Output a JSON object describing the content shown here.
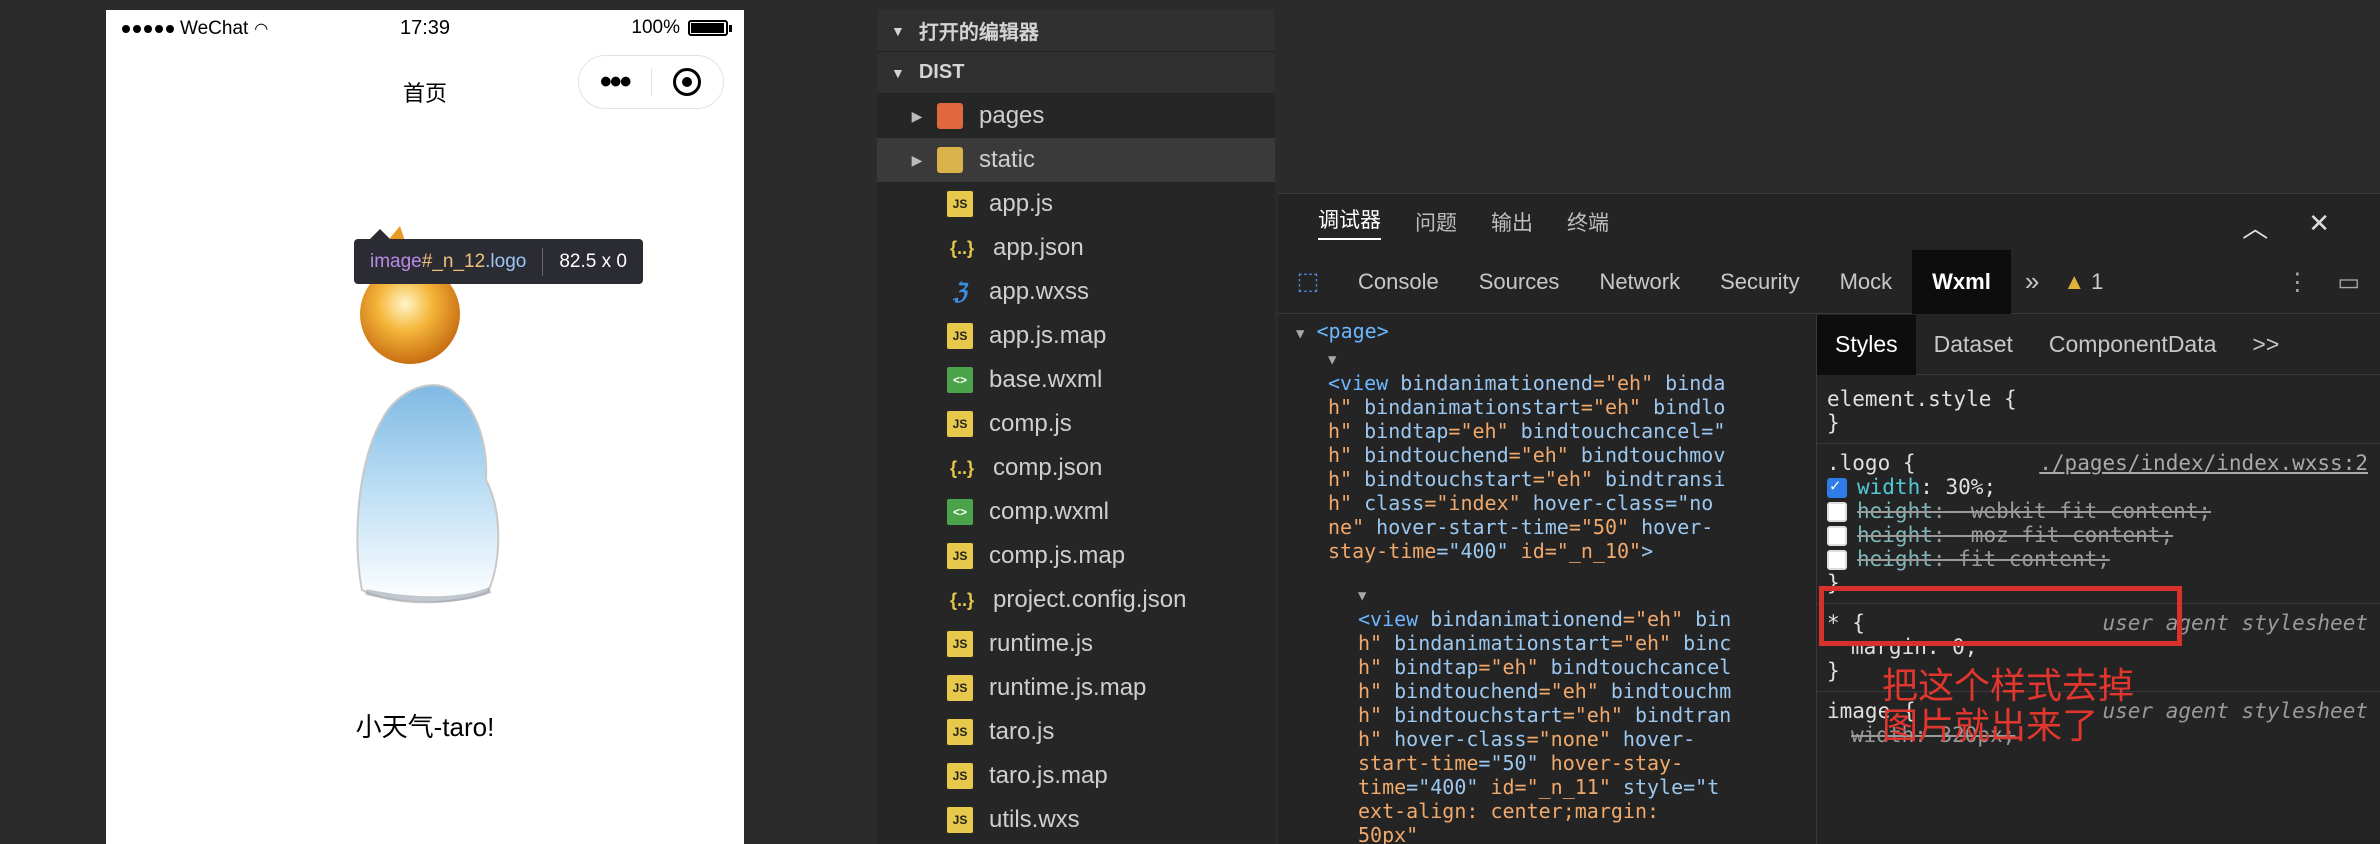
{
  "phone": {
    "carrier": "WeChat",
    "time": "17:39",
    "battery": "100%",
    "nav_title": "首页",
    "capsule_more": "•••",
    "inspect": {
      "tag": "image",
      "id": "#_n_12",
      "cls": ".logo",
      "size": "82.5 x 0"
    },
    "weather_text": "小天气-taro!"
  },
  "explorer": {
    "sections": [
      {
        "label": "打开的编辑器"
      },
      {
        "label": "DIST"
      }
    ],
    "items": [
      {
        "label": "pages",
        "icon": "folder-pages-icon",
        "kind": "folder"
      },
      {
        "label": "static",
        "icon": "folder-static-icon",
        "kind": "folder"
      },
      {
        "label": "app.js",
        "icon": "js-file-icon",
        "kind": "js"
      },
      {
        "label": "app.json",
        "icon": "json-file-icon",
        "kind": "json"
      },
      {
        "label": "app.wxss",
        "icon": "wxss-file-icon",
        "kind": "wxss"
      },
      {
        "label": "app.js.map",
        "icon": "map-file-icon",
        "kind": "map"
      },
      {
        "label": "base.wxml",
        "icon": "wxml-file-icon",
        "kind": "wxml"
      },
      {
        "label": "comp.js",
        "icon": "js-file-icon",
        "kind": "js"
      },
      {
        "label": "comp.json",
        "icon": "json-file-icon",
        "kind": "json"
      },
      {
        "label": "comp.wxml",
        "icon": "wxml-file-icon",
        "kind": "wxml"
      },
      {
        "label": "comp.js.map",
        "icon": "map-file-icon",
        "kind": "map"
      },
      {
        "label": "project.config.json",
        "icon": "json-file-icon",
        "kind": "json"
      },
      {
        "label": "runtime.js",
        "icon": "js-file-icon",
        "kind": "js"
      },
      {
        "label": "runtime.js.map",
        "icon": "map-file-icon",
        "kind": "map"
      },
      {
        "label": "taro.js",
        "icon": "js-file-icon",
        "kind": "js"
      },
      {
        "label": "taro.js.map",
        "icon": "map-file-icon",
        "kind": "map"
      },
      {
        "label": "utils.wxs",
        "icon": "js-file-icon",
        "kind": "js"
      }
    ]
  },
  "devtools": {
    "top_tabs": [
      "调试器",
      "问题",
      "输出",
      "终端"
    ],
    "tool_tabs": [
      "Console",
      "Sources",
      "Network",
      "Security",
      "Mock",
      "Wxml"
    ],
    "warning_count": "1",
    "more": "»",
    "dom": {
      "page_tag": "<page>",
      "view1": [
        [
          "<view ",
          "bindanimationend",
          "=\"eh\" ",
          "binda"
        ],
        [
          "h\" ",
          "bindanimationstart",
          "=\"eh\" ",
          "bindlo"
        ],
        [
          "h\" ",
          "bindtap",
          "=\"eh\" ",
          "bindtouchcancel=\""
        ],
        [
          "h\" ",
          "bindtouchend",
          "=\"eh\" ",
          "bindtouchmov"
        ],
        [
          "h\" ",
          "bindtouchstart",
          "=\"eh\" ",
          "bindtransi"
        ],
        [
          "h\" ",
          "class",
          "=\"index\" ",
          "hover-class=\"no"
        ],
        [
          "ne\" ",
          "hover-start-time",
          "=\"50\" ",
          "hover-"
        ],
        [
          "stay-time",
          "=\"400\" ",
          "id=\"_n_10\"",
          ">"
        ]
      ],
      "view2": [
        [
          "<view ",
          "bindanimationend",
          "=\"eh\" ",
          "bin"
        ],
        [
          "h\" ",
          "bindanimationstart",
          "=\"eh\" ",
          "binc"
        ],
        [
          "h\" ",
          "bindtap",
          "=\"eh\" ",
          "bindtouchcancel"
        ],
        [
          "h\" ",
          "bindtouchend",
          "=\"eh\" ",
          "bindtouchm"
        ],
        [
          "h\" ",
          "bindtouchstart",
          "=\"eh\" ",
          "bindtran"
        ],
        [
          "h\" ",
          "hover-class",
          "=\"none\" ",
          "hover-"
        ],
        [
          "start-time",
          "=\"50\" ",
          "hover-stay-",
          ""
        ],
        [
          "time",
          "=\"400\" ",
          "id=\"_n_11\" ",
          "style=\"t"
        ],
        [
          "ext-align: center;margin:",
          "",
          "",
          ""
        ],
        [
          "50px\"",
          "",
          "",
          ""
        ]
      ]
    },
    "styles": {
      "tabs": [
        "Styles",
        "Dataset",
        "ComponentData",
        ">>"
      ],
      "element_style": "element.style {",
      "close_brace": "}",
      "logo_selector": ".logo {",
      "logo_source": "./pages/index/index.wxss:2",
      "logo_rules": [
        {
          "prop": "width",
          "value": "30%;",
          "checked": true
        },
        {
          "prop": "height",
          "value": "-webkit-fit-content;",
          "checked": false
        },
        {
          "prop": "height",
          "value": "-moz-fit-content;",
          "checked": false
        },
        {
          "prop": "height",
          "value": "fit-content;",
          "checked": false
        }
      ],
      "star_selector": "* {",
      "star_rule": "margin: 0;",
      "ua_label": "user agent stylesheet",
      "image_selector": "image {",
      "image_rule": "width: 320px;"
    },
    "annotation": [
      "把这个样式去掉",
      "图片就出来了"
    ]
  }
}
